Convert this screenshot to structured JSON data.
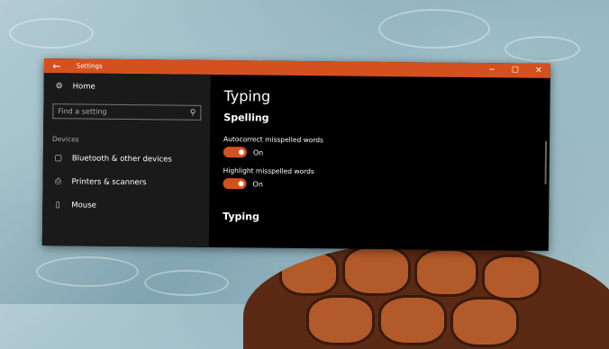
{
  "window": {
    "title": "Settings",
    "back_icon": "back-arrow-icon",
    "controls": {
      "minimize": "─",
      "maximize": "☐",
      "close": "✕"
    }
  },
  "sidebar": {
    "home_label": "Home",
    "search_placeholder": "Find a setting",
    "group_label": "Devices",
    "items": [
      {
        "label": "Bluetooth & other devices",
        "icon": "bluetooth-devices-icon"
      },
      {
        "label": "Printers & scanners",
        "icon": "printer-icon"
      },
      {
        "label": "Mouse",
        "icon": "mouse-icon"
      }
    ]
  },
  "main": {
    "page_title": "Typing",
    "section_spelling": "Spelling",
    "settings": [
      {
        "label": "Autocorrect misspelled words",
        "state": "On",
        "on": true
      },
      {
        "label": "Highlight misspelled words",
        "state": "On",
        "on": true
      }
    ],
    "section_typing": "Typing"
  },
  "colors": {
    "accent": "#d4511f",
    "window_bg": "#000000",
    "sidebar_bg": "#1a1a1a"
  }
}
